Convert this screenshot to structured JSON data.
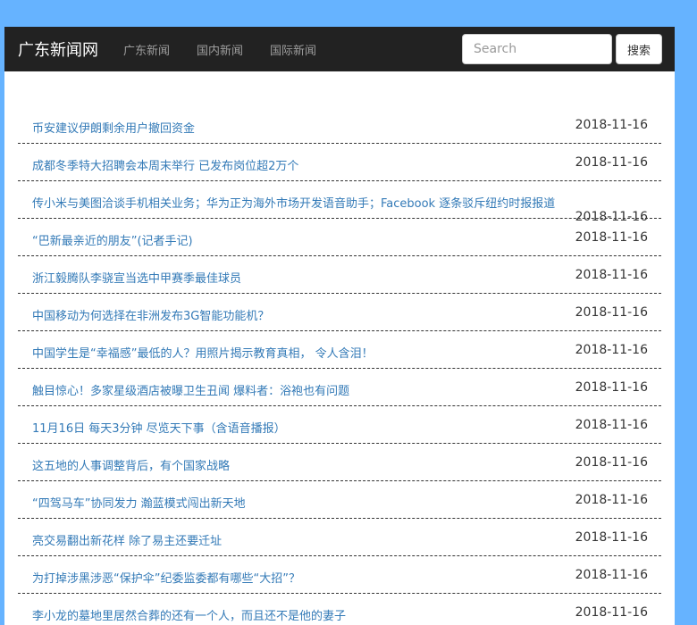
{
  "navbar": {
    "brand": "广东新闻网",
    "links": [
      "广东新闻",
      "国内新闻",
      "国际新闻"
    ],
    "search_placeholder": "Search",
    "search_button": "搜索"
  },
  "news": [
    {
      "title": "币安建议伊朗剩余用户撤回资金",
      "date": "2018-11-16"
    },
    {
      "title": "成都冬季特大招聘会本周末举行 已发布岗位超2万个",
      "date": "2018-11-16"
    },
    {
      "title": "传小米与美图洽谈手机相关业务；华为正为海外市场开发语音助手；Facebook 逐条驳斥纽约时报报道",
      "date": "2018-11-16"
    },
    {
      "title": "“巴新最亲近的朋友”(记者手记)",
      "date": "2018-11-16"
    },
    {
      "title": "浙江毅腾队李骁宣当选中甲赛季最佳球员",
      "date": "2018-11-16"
    },
    {
      "title": "中国移动为何选择在非洲发布3G智能功能机？",
      "date": "2018-11-16"
    },
    {
      "title": "中国学生是“幸福感”最低的人？用照片揭示教育真相， 令人含泪！",
      "date": "2018-11-16"
    },
    {
      "title": "触目惊心！多家星级酒店被曝卫生丑闻 爆料者：浴袍也有问题",
      "date": "2018-11-16"
    },
    {
      "title": "11月16日 每天3分钟 尽览天下事（含语音播报）",
      "date": "2018-11-16"
    },
    {
      "title": "这五地的人事调整背后，有个国家战略",
      "date": "2018-11-16"
    },
    {
      "title": "“四驾马车”协同发力 瀚蓝模式闯出新天地",
      "date": "2018-11-16"
    },
    {
      "title": "亮交易翻出新花样 除了易主还要迁址",
      "date": "2018-11-16"
    },
    {
      "title": "为打掉涉黑涉恶“保护伞”纪委监委都有哪些“大招”？",
      "date": "2018-11-16"
    },
    {
      "title": "李小龙的墓地里居然合葬的还有一个人，而且还不是他的妻子",
      "date": "2018-11-16"
    }
  ]
}
